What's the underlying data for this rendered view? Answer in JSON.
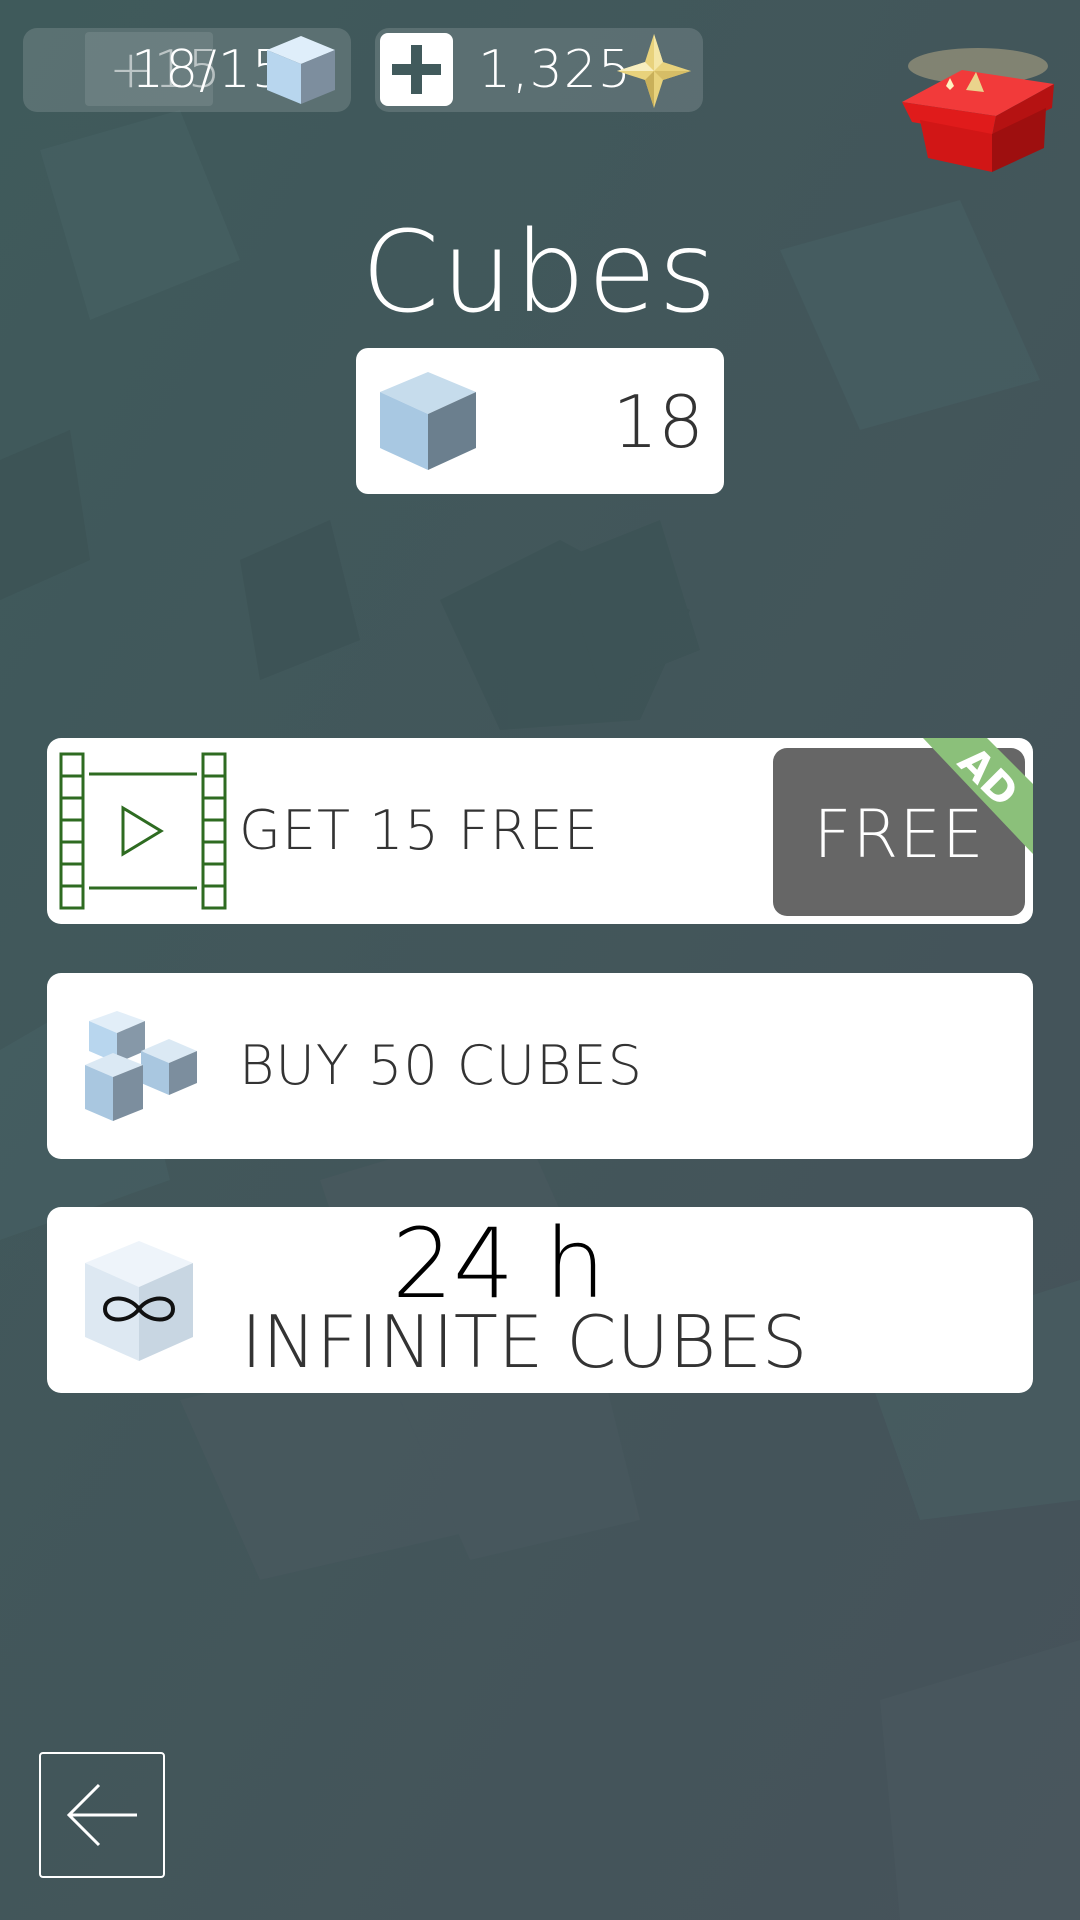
{
  "hud": {
    "cubes": {
      "overlay_text": "+15",
      "count_text": "18/15",
      "icon": "cube-icon"
    },
    "stars": {
      "value": "1,325",
      "add_icon": "plus-icon",
      "icon": "star-icon"
    },
    "gift": {
      "icon": "gift-box-icon"
    }
  },
  "title": "Cubes",
  "current": {
    "icon": "cube-icon",
    "value": "18"
  },
  "offers": [
    {
      "id": "free",
      "icon": "video-film-icon",
      "label": "GET 15 FREE",
      "button": "FREE",
      "badge": "AD"
    },
    {
      "id": "buy50",
      "icon": "cubes-pack-icon",
      "label": "BUY 50 CUBES"
    },
    {
      "id": "infinite",
      "icon": "infinite-cube-icon",
      "duration": "24 h",
      "label": "INFINITE CUBES"
    }
  ],
  "back": {
    "icon": "back-arrow-icon"
  },
  "colors": {
    "background": "#415a5c",
    "free_button": "#666666",
    "ad_badge": "#8bc07a",
    "film_icon": "#2e6b21",
    "gift": "#e01b1b",
    "star": "#e8d27c"
  }
}
